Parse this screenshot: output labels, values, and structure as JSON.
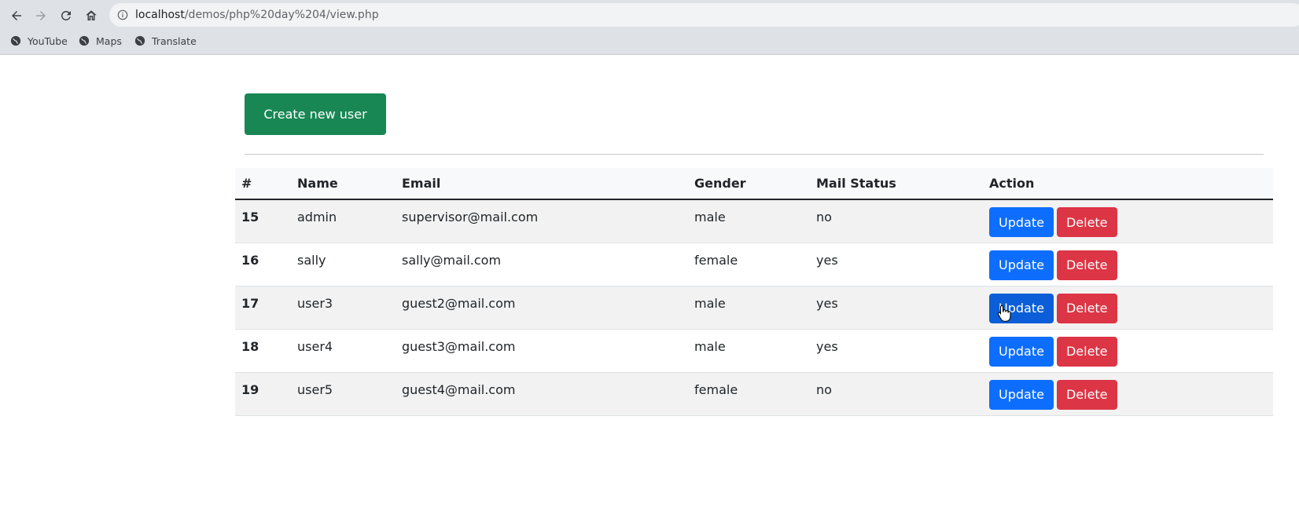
{
  "browser": {
    "url_host": "localhost",
    "url_path": "/demos/php%20day%204/view.php",
    "bookmarks": [
      {
        "label": "YouTube",
        "icon": "globe-icon"
      },
      {
        "label": "Maps",
        "icon": "globe-icon"
      },
      {
        "label": "Translate",
        "icon": "globe-icon"
      }
    ]
  },
  "page": {
    "create_button": "Create new user",
    "table": {
      "headers": [
        "#",
        "Name",
        "Email",
        "Gender",
        "Mail Status",
        "Action"
      ],
      "rows": [
        {
          "id": "15",
          "name": "admin",
          "email": "supervisor@mail.com",
          "gender": "male",
          "mail_status": "no",
          "update": "Update",
          "delete": "Delete"
        },
        {
          "id": "16",
          "name": "sally",
          "email": "sally@mail.com",
          "gender": "female",
          "mail_status": "yes",
          "update": "Update",
          "delete": "Delete"
        },
        {
          "id": "17",
          "name": "user3",
          "email": "guest2@mail.com",
          "gender": "male",
          "mail_status": "yes",
          "update": "Update",
          "delete": "Delete"
        },
        {
          "id": "18",
          "name": "user4",
          "email": "guest3@mail.com",
          "gender": "male",
          "mail_status": "yes",
          "update": "Update",
          "delete": "Delete"
        },
        {
          "id": "19",
          "name": "user5",
          "email": "guest4@mail.com",
          "gender": "female",
          "mail_status": "no",
          "update": "Update",
          "delete": "Delete"
        }
      ]
    }
  },
  "colors": {
    "create_button": "#198754",
    "update_button": "#0d6efd",
    "update_button_hover": "#0b5ed7",
    "delete_button": "#dc3545"
  }
}
